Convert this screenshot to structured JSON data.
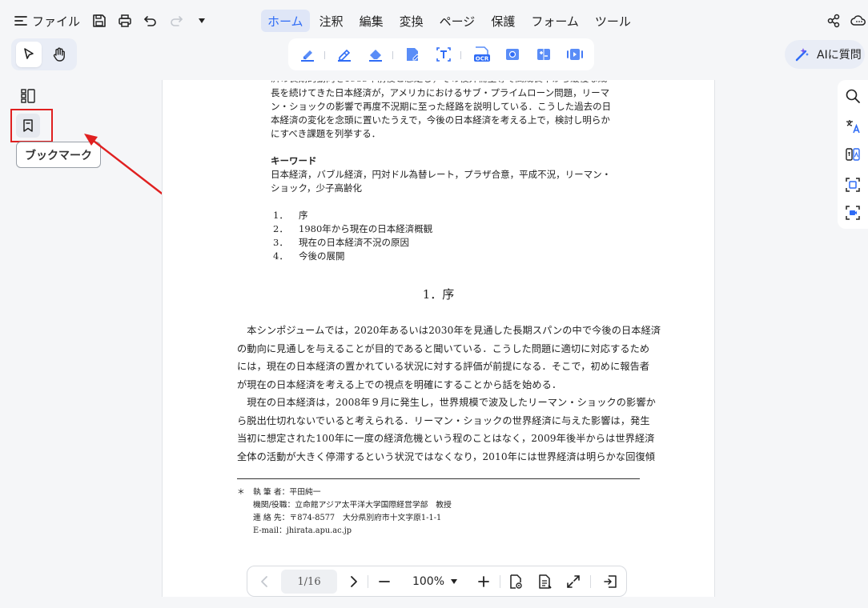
{
  "menu": {
    "file_label": "ファイル",
    "tabs": [
      "ホーム",
      "注釈",
      "編集",
      "変換",
      "ページ",
      "保護",
      "フォーム",
      "ツール"
    ],
    "active_tab": "ホーム"
  },
  "ai_button": {
    "label": "AIに質問"
  },
  "left_panel": {
    "tooltip": "ブックマーク"
  },
  "document": {
    "abstract_lines": [
      "長を続けてきた日本経済が，アメリカにおけるサブ・プライムローン問題，リーマ",
      "ン・ショックの影響で再度不況期に至った経路を説明している．こうした過去の日",
      "本経済の変化を念頭に置いたうえで，今後の日本経済を考える上で，検討し明らか",
      "にすべき課題を列挙する．"
    ],
    "keywords_heading": "キーワード",
    "keywords_lines": [
      "日本経済，バブル経済，円対ドル為替レート，プラザ合意，平成不況，リーマン・",
      "ショック，少子高齢化"
    ],
    "toc": [
      {
        "num": "1．",
        "title": "序"
      },
      {
        "num": "2．",
        "title": "1980年から現在の日本経済概観"
      },
      {
        "num": "3．",
        "title": "現在の日本経済不況の原因"
      },
      {
        "num": "4．",
        "title": "今後の展開"
      }
    ],
    "section_title": "1．序",
    "body_lines": [
      "　本シンポジュームでは，2020年あるいは2030年を見通した長期スパンの中で今後の日本経済",
      "の動向に見通しを与えることが目的であると聞いている．こうした問題に適切に対応するため",
      "には，現在の日本経済の置かれている状況に対する評価が前提になる．そこで，初めに報告者",
      "が現在の日本経済を考える上での視点を明確にすることから話を始める．",
      "　現在の日本経済は，2008年９月に発生し，世界規模で波及したリーマン・ショックの影響か",
      "ら脱出仕切れないでいると考えられる．リーマン・ショックの世界経済に与えた影響は，発生",
      "当初に想定された100年に一度の経済危機という程のことはなく，2009年後半からは世界経済",
      "全体の活動が大きく停滞するという状況ではなくなり，2010年には世界経済は明らかな回復傾"
    ],
    "footnote": {
      "marker": "＊",
      "lines": [
        "執 筆 者：平田純一",
        "機関/役職：立命館アジア太平洋大学国際経営学部　教授",
        "連 絡 先：〒874-8577　大分県別府市十文字原1-1-1",
        "E-mail：jhirata.apu.ac.jp"
      ]
    }
  },
  "bottom_nav": {
    "page_indicator": "1/16",
    "zoom": "100%"
  },
  "colors": {
    "accent": "#2f6cf6",
    "highlight_box": "#e02020",
    "arrow": "#e02020"
  }
}
